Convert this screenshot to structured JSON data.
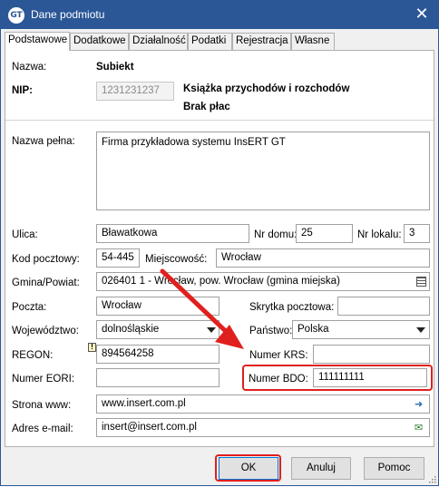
{
  "window": {
    "title": "Dane podmiotu",
    "icon": "insert-gt-logo",
    "icon_text": "GT"
  },
  "tabs": [
    "Podstawowe",
    "Dodatkowe",
    "Działalność",
    "Podatki",
    "Rejestracja",
    "Własne"
  ],
  "header": {
    "nazwa_label": "Nazwa:",
    "nazwa_value": "Subiekt",
    "nip_label": "NIP:",
    "nip_value": "1231231237",
    "ksiegowosc": "Książka przychodów i rozchodów",
    "place": "Brak płac"
  },
  "form": {
    "nazwa_pelna_label": "Nazwa pełna:",
    "nazwa_pelna_value": "Firma przykładowa systemu InsERT GT",
    "ulica_label": "Ulica:",
    "ulica_value": "Bławatkowa",
    "nr_domu_label": "Nr domu:",
    "nr_domu_value": "25",
    "nr_lokalu_label": "Nr lokalu:",
    "nr_lokalu_value": "3",
    "kod_label": "Kod pocztowy:",
    "kod_value": "54-445",
    "miejscowosc_label": "Miejscowość:",
    "miejscowosc_value": "Wrocław",
    "gmina_label": "Gmina/Powiat:",
    "gmina_value": "026401 1 - Wrocław, pow. Wrocław (gmina miejska)",
    "poczta_label": "Poczta:",
    "poczta_value": "Wrocław",
    "skrytka_label": "Skrytka pocztowa:",
    "skrytka_value": "",
    "woj_label": "Województwo:",
    "woj_value": "dolnośląskie",
    "panstwo_label": "Państwo:",
    "panstwo_value": "Polska",
    "regon_label": "REGON:",
    "regon_value": "894564258",
    "krs_label": "Numer KRS:",
    "krs_value": "",
    "eori_label": "Numer EORI:",
    "eori_value": "",
    "bdo_label": "Numer BDO:",
    "bdo_value": "111111111",
    "www_label": "Strona www:",
    "www_value": "www.insert.com.pl",
    "email_label": "Adres e-mail:",
    "email_value": "insert@insert.com.pl"
  },
  "buttons": {
    "ok": "OK",
    "cancel": "Anuluj",
    "help": "Pomoc"
  },
  "icons": {
    "close": "close-icon",
    "warning": "warning-icon",
    "list": "list-icon",
    "www_go": "globe-arrow-icon",
    "email_go": "mail-arrow-icon",
    "dropdown": "chevron-down-icon"
  },
  "annotations": {
    "highlight_color": "#e0201e",
    "arrow_color": "#e0201e"
  }
}
